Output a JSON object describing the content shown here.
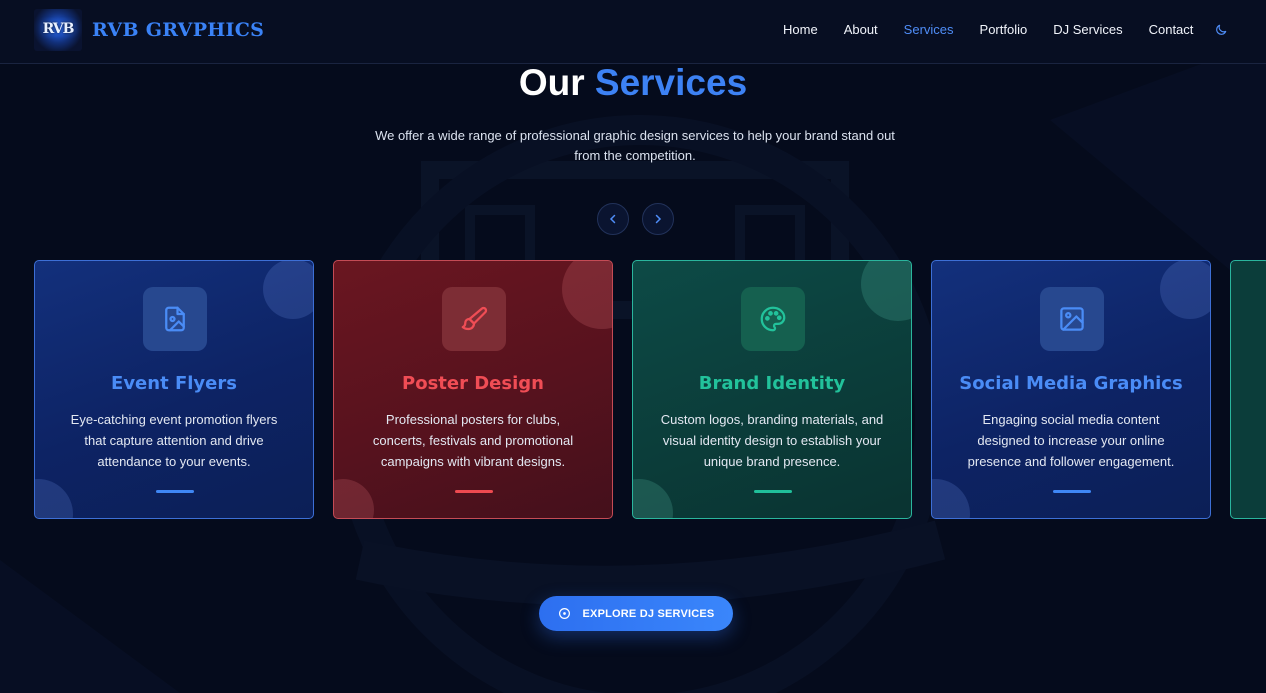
{
  "header": {
    "logo_text": "RVB",
    "brand": "RVB GRVPHICS",
    "nav": [
      {
        "label": "Home",
        "active": false
      },
      {
        "label": "About",
        "active": false
      },
      {
        "label": "Services",
        "active": true
      },
      {
        "label": "Portfolio",
        "active": false
      },
      {
        "label": "DJ Services",
        "active": false
      },
      {
        "label": "Contact",
        "active": false
      }
    ],
    "theme_toggle_icon": "moon-icon"
  },
  "section": {
    "title_main": "Our",
    "title_accent": "Services",
    "subtitle": "We offer a wide range of professional graphic design services to help your brand stand out from the competition."
  },
  "carousel": {
    "prev_icon": "chevron-left-icon",
    "next_icon": "chevron-right-icon",
    "cards": [
      {
        "title": "Event Flyers",
        "description": "Eye-catching event promotion flyers that capture attention and drive attendance to your events.",
        "icon": "file-image-icon",
        "theme": "blue"
      },
      {
        "title": "Poster Design",
        "description": "Professional posters for clubs, concerts, festivals and promotional campaigns with vibrant designs.",
        "icon": "paintbrush-icon",
        "theme": "red"
      },
      {
        "title": "Brand Identity",
        "description": "Custom logos, branding materials, and visual identity design to establish your unique brand presence.",
        "icon": "palette-icon",
        "theme": "teal"
      },
      {
        "title": "Social Media Graphics",
        "description": "Engaging social media content designed to increase your online presence and follower engagement.",
        "icon": "image-icon",
        "theme": "blue"
      }
    ]
  },
  "cta": {
    "label": "EXPLORE DJ SERVICES",
    "icon": "play-circle-icon"
  },
  "colors": {
    "background": "#050b1c",
    "accent_blue": "#3d82f4",
    "accent_red": "#f04d55",
    "accent_teal": "#22c29b"
  }
}
